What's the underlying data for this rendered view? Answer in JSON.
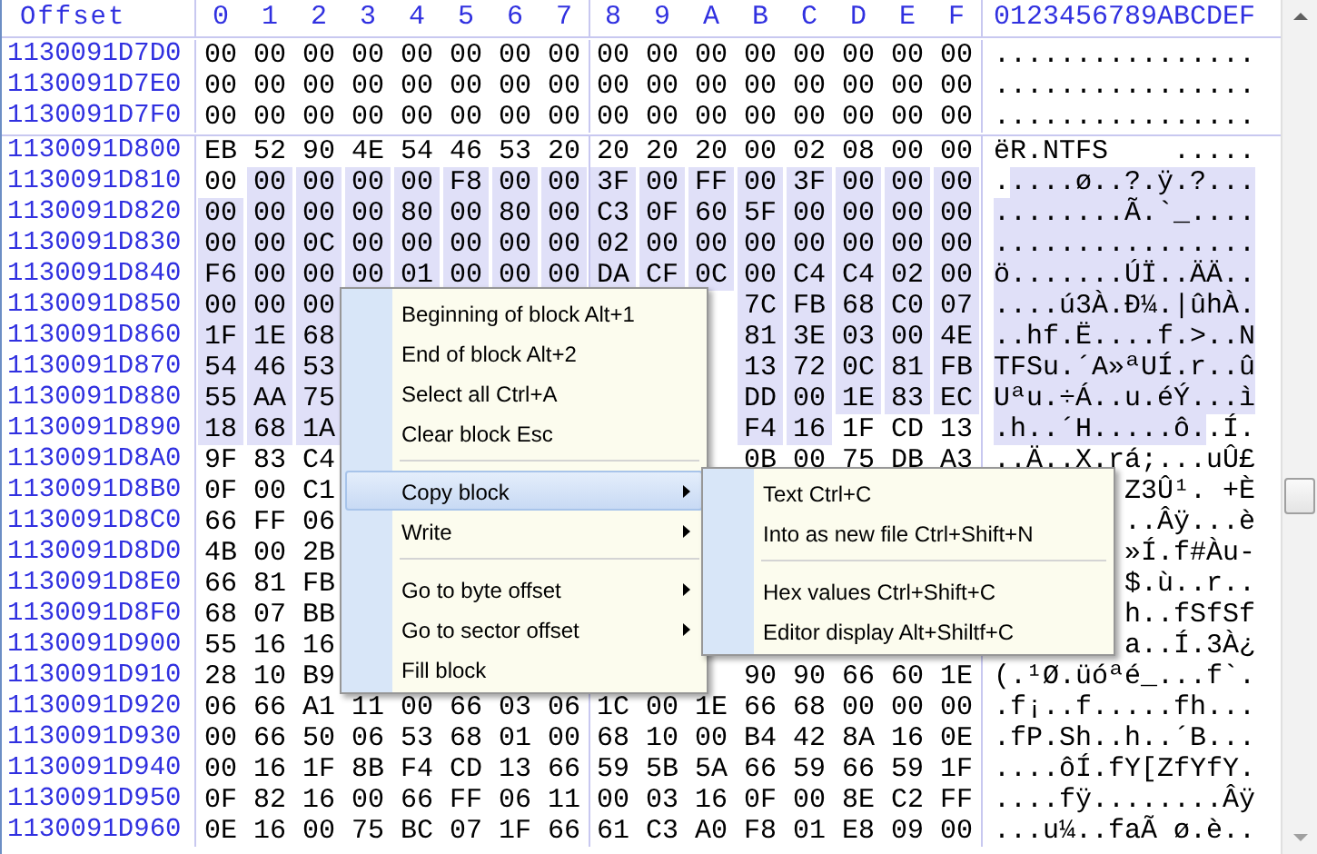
{
  "columns": {
    "offset": "Offset",
    "hex": [
      "0",
      "1",
      "2",
      "3",
      "4",
      "5",
      "6",
      "7",
      "8",
      "9",
      "A",
      "B",
      "C",
      "D",
      "E",
      "F"
    ],
    "text": "0123456789ABCDEF"
  },
  "rows": [
    {
      "offset": "1130091D7D0",
      "bytes": [
        {
          "v": "00",
          "selected": false
        },
        {
          "v": "00",
          "selected": false
        },
        {
          "v": "00",
          "selected": false
        },
        {
          "v": "00",
          "selected": false
        },
        {
          "v": "00",
          "selected": false
        },
        {
          "v": "00",
          "selected": false
        },
        {
          "v": "00",
          "selected": false
        },
        {
          "v": "00",
          "selected": false
        },
        {
          "v": "00",
          "selected": false
        },
        {
          "v": "00",
          "selected": false
        },
        {
          "v": "00",
          "selected": false
        },
        {
          "v": "00",
          "selected": false
        },
        {
          "v": "00",
          "selected": false
        },
        {
          "v": "00",
          "selected": false
        },
        {
          "v": "00",
          "selected": false
        },
        {
          "v": "00",
          "selected": false
        }
      ],
      "text": [
        {
          "s": "................",
          "selected": false
        }
      ]
    },
    {
      "offset": "1130091D7E0",
      "bytes": [
        {
          "v": "00",
          "selected": false
        },
        {
          "v": "00",
          "selected": false
        },
        {
          "v": "00",
          "selected": false
        },
        {
          "v": "00",
          "selected": false
        },
        {
          "v": "00",
          "selected": false
        },
        {
          "v": "00",
          "selected": false
        },
        {
          "v": "00",
          "selected": false
        },
        {
          "v": "00",
          "selected": false
        },
        {
          "v": "00",
          "selected": false
        },
        {
          "v": "00",
          "selected": false
        },
        {
          "v": "00",
          "selected": false
        },
        {
          "v": "00",
          "selected": false
        },
        {
          "v": "00",
          "selected": false
        },
        {
          "v": "00",
          "selected": false
        },
        {
          "v": "00",
          "selected": false
        },
        {
          "v": "00",
          "selected": false
        }
      ],
      "text": [
        {
          "s": "................",
          "selected": false
        }
      ]
    },
    {
      "offset": "1130091D7F0",
      "bytes": [
        {
          "v": "00",
          "selected": false
        },
        {
          "v": "00",
          "selected": false
        },
        {
          "v": "00",
          "selected": false
        },
        {
          "v": "00",
          "selected": false
        },
        {
          "v": "00",
          "selected": false
        },
        {
          "v": "00",
          "selected": false
        },
        {
          "v": "00",
          "selected": false
        },
        {
          "v": "00",
          "selected": false
        },
        {
          "v": "00",
          "selected": false
        },
        {
          "v": "00",
          "selected": false
        },
        {
          "v": "00",
          "selected": false
        },
        {
          "v": "00",
          "selected": false
        },
        {
          "v": "00",
          "selected": false
        },
        {
          "v": "00",
          "selected": false
        },
        {
          "v": "00",
          "selected": false
        },
        {
          "v": "00",
          "selected": false
        }
      ],
      "text": [
        {
          "s": "................",
          "selected": false
        }
      ]
    },
    {
      "offset": "1130091D800",
      "bytes": [
        {
          "v": "EB",
          "selected": false
        },
        {
          "v": "52",
          "selected": false
        },
        {
          "v": "90",
          "selected": false
        },
        {
          "v": "4E",
          "selected": false
        },
        {
          "v": "54",
          "selected": false
        },
        {
          "v": "46",
          "selected": false
        },
        {
          "v": "53",
          "selected": false
        },
        {
          "v": "20",
          "selected": false
        },
        {
          "v": "20",
          "selected": false
        },
        {
          "v": "20",
          "selected": false
        },
        {
          "v": "20",
          "selected": false
        },
        {
          "v": "00",
          "selected": false
        },
        {
          "v": "02",
          "selected": false
        },
        {
          "v": "08",
          "selected": false
        },
        {
          "v": "00",
          "selected": false
        },
        {
          "v": "00",
          "selected": false
        }
      ],
      "text": [
        {
          "s": "ëR.NTFS    .....",
          "selected": false
        }
      ]
    },
    {
      "offset": "1130091D810",
      "bytes": [
        {
          "v": "00",
          "selected": false
        },
        {
          "v": "00",
          "selected": true
        },
        {
          "v": "00",
          "selected": true
        },
        {
          "v": "00",
          "selected": true
        },
        {
          "v": "00",
          "selected": true
        },
        {
          "v": "F8",
          "selected": true
        },
        {
          "v": "00",
          "selected": true
        },
        {
          "v": "00",
          "selected": true
        },
        {
          "v": "3F",
          "selected": true
        },
        {
          "v": "00",
          "selected": true
        },
        {
          "v": "FF",
          "selected": true
        },
        {
          "v": "00",
          "selected": true
        },
        {
          "v": "3F",
          "selected": true
        },
        {
          "v": "00",
          "selected": true
        },
        {
          "v": "00",
          "selected": true
        },
        {
          "v": "00",
          "selected": true
        }
      ],
      "text": [
        {
          "s": ".",
          "selected": false
        },
        {
          "s": "....ø..?.ÿ.?...",
          "selected": true
        }
      ]
    },
    {
      "offset": "1130091D820",
      "bytes": [
        {
          "v": "00",
          "selected": true
        },
        {
          "v": "00",
          "selected": true
        },
        {
          "v": "00",
          "selected": true
        },
        {
          "v": "00",
          "selected": true
        },
        {
          "v": "80",
          "selected": true
        },
        {
          "v": "00",
          "selected": true
        },
        {
          "v": "80",
          "selected": true
        },
        {
          "v": "00",
          "selected": true
        },
        {
          "v": "C3",
          "selected": true
        },
        {
          "v": "0F",
          "selected": true
        },
        {
          "v": "60",
          "selected": true
        },
        {
          "v": "5F",
          "selected": true
        },
        {
          "v": "00",
          "selected": true
        },
        {
          "v": "00",
          "selected": true
        },
        {
          "v": "00",
          "selected": true
        },
        {
          "v": "00",
          "selected": true
        }
      ],
      "text": [
        {
          "s": "........Ã.`_....",
          "selected": true
        }
      ]
    },
    {
      "offset": "1130091D830",
      "bytes": [
        {
          "v": "00",
          "selected": true
        },
        {
          "v": "00",
          "selected": true
        },
        {
          "v": "0C",
          "selected": true
        },
        {
          "v": "00",
          "selected": true
        },
        {
          "v": "00",
          "selected": true
        },
        {
          "v": "00",
          "selected": true
        },
        {
          "v": "00",
          "selected": true
        },
        {
          "v": "00",
          "selected": true
        },
        {
          "v": "02",
          "selected": true
        },
        {
          "v": "00",
          "selected": true
        },
        {
          "v": "00",
          "selected": true
        },
        {
          "v": "00",
          "selected": true
        },
        {
          "v": "00",
          "selected": true
        },
        {
          "v": "00",
          "selected": true
        },
        {
          "v": "00",
          "selected": true
        },
        {
          "v": "00",
          "selected": true
        }
      ],
      "text": [
        {
          "s": "................",
          "selected": true
        }
      ]
    },
    {
      "offset": "1130091D840",
      "bytes": [
        {
          "v": "F6",
          "selected": true
        },
        {
          "v": "00",
          "selected": true
        },
        {
          "v": "00",
          "selected": true
        },
        {
          "v": "00",
          "selected": true
        },
        {
          "v": "01",
          "selected": true
        },
        {
          "v": "00",
          "selected": true
        },
        {
          "v": "00",
          "selected": true
        },
        {
          "v": "00",
          "selected": true
        },
        {
          "v": "DA",
          "selected": true
        },
        {
          "v": "CF",
          "selected": true
        },
        {
          "v": "0C",
          "selected": true
        },
        {
          "v": "00",
          "selected": true
        },
        {
          "v": "C4",
          "selected": true
        },
        {
          "v": "C4",
          "selected": true
        },
        {
          "v": "02",
          "selected": true
        },
        {
          "v": "00",
          "selected": true
        }
      ],
      "text": [
        {
          "s": "ö.......ÚÏ..ÄÄ..",
          "selected": true
        }
      ]
    },
    {
      "offset": "1130091D850",
      "bytes": [
        {
          "v": "00",
          "selected": true
        },
        {
          "v": "00",
          "selected": true
        },
        {
          "v": "00",
          "selected": true
        }
      ],
      "bytes_right": [
        {
          "v": "7C",
          "selected": true
        },
        {
          "v": "FB",
          "selected": true
        },
        {
          "v": "68",
          "selected": true
        },
        {
          "v": "C0",
          "selected": true
        },
        {
          "v": "07",
          "selected": true
        }
      ],
      "text": [
        {
          "s": "....ú3À.Ð¼.|ûhÀ.",
          "selected": true
        }
      ]
    },
    {
      "offset": "1130091D860",
      "bytes": [
        {
          "v": "1F",
          "selected": true
        },
        {
          "v": "1E",
          "selected": true
        },
        {
          "v": "68",
          "selected": true
        }
      ],
      "bytes_right": [
        {
          "v": "81",
          "selected": true
        },
        {
          "v": "3E",
          "selected": true
        },
        {
          "v": "03",
          "selected": true
        },
        {
          "v": "00",
          "selected": true
        },
        {
          "v": "4E",
          "selected": true
        }
      ],
      "text": [
        {
          "s": "..hf.Ë....f.>..N",
          "selected": true
        }
      ]
    },
    {
      "offset": "1130091D870",
      "bytes": [
        {
          "v": "54",
          "selected": true
        },
        {
          "v": "46",
          "selected": true
        },
        {
          "v": "53",
          "selected": true
        }
      ],
      "bytes_right": [
        {
          "v": "13",
          "selected": true
        },
        {
          "v": "72",
          "selected": true
        },
        {
          "v": "0C",
          "selected": true
        },
        {
          "v": "81",
          "selected": true
        },
        {
          "v": "FB",
          "selected": true
        }
      ],
      "text": [
        {
          "s": "TFSu.´A»ªUÍ.r..û",
          "selected": true
        }
      ]
    },
    {
      "offset": "1130091D880",
      "bytes": [
        {
          "v": "55",
          "selected": true
        },
        {
          "v": "AA",
          "selected": true
        },
        {
          "v": "75",
          "selected": true
        }
      ],
      "bytes_right": [
        {
          "v": "DD",
          "selected": true
        },
        {
          "v": "00",
          "selected": true
        },
        {
          "v": "1E",
          "selected": true
        },
        {
          "v": "83",
          "selected": true
        },
        {
          "v": "EC",
          "selected": true
        }
      ],
      "text": [
        {
          "s": "Uªu.÷Á..u.éÝ...ì",
          "selected": true
        }
      ]
    },
    {
      "offset": "1130091D890",
      "bytes": [
        {
          "v": "18",
          "selected": true
        },
        {
          "v": "68",
          "selected": true
        },
        {
          "v": "1A",
          "selected": true
        }
      ],
      "bytes_right": [
        {
          "v": "F4",
          "selected": true
        },
        {
          "v": "16",
          "selected": true
        },
        {
          "v": "1F",
          "selected": false
        },
        {
          "v": "CD",
          "selected": false
        },
        {
          "v": "13",
          "selected": false
        }
      ],
      "text": [
        {
          "s": ".h..´H.....ô.",
          "selected": true
        },
        {
          "s": ".Í.",
          "selected": false
        }
      ]
    },
    {
      "offset": "1130091D8A0",
      "bytes": [
        {
          "v": "9F",
          "selected": false
        },
        {
          "v": "83",
          "selected": false
        },
        {
          "v": "C4",
          "selected": false
        }
      ],
      "bytes_right": [
        {
          "v": "0B",
          "selected": false
        },
        {
          "v": "00",
          "selected": false
        },
        {
          "v": "75",
          "selected": false
        },
        {
          "v": "DB",
          "selected": false
        },
        {
          "v": "A3",
          "selected": false
        }
      ],
      "text": [
        {
          "s": "..Ä..X.rá;...uÛ£",
          "selected": false
        }
      ]
    },
    {
      "offset": "1130091D8B0",
      "bytes": [
        {
          "v": "0F",
          "selected": false
        },
        {
          "v": "00",
          "selected": false
        },
        {
          "v": "C1",
          "selected": false
        }
      ],
      "text": [
        {
          "s": "Z3Û¹. +È",
          "selected": false
        }
      ]
    },
    {
      "offset": "1130091D8C0",
      "bytes": [
        {
          "v": "66",
          "selected": false
        },
        {
          "v": "FF",
          "selected": false
        },
        {
          "v": "06",
          "selected": false
        }
      ],
      "text": [
        {
          "s": "..Âÿ...è",
          "selected": false
        }
      ]
    },
    {
      "offset": "1130091D8D0",
      "bytes": [
        {
          "v": "4B",
          "selected": false
        },
        {
          "v": "00",
          "selected": false
        },
        {
          "v": "2B",
          "selected": false
        }
      ],
      "text": [
        {
          "s": "»Í.f#Àu-",
          "selected": false
        }
      ]
    },
    {
      "offset": "1130091D8E0",
      "bytes": [
        {
          "v": "66",
          "selected": false
        },
        {
          "v": "81",
          "selected": false
        },
        {
          "v": "FB",
          "selected": false
        }
      ],
      "text": [
        {
          "s": "$.ù..r..",
          "selected": false
        }
      ]
    },
    {
      "offset": "1130091D8F0",
      "bytes": [
        {
          "v": "68",
          "selected": false
        },
        {
          "v": "07",
          "selected": false
        },
        {
          "v": "BB",
          "selected": false
        }
      ],
      "text": [
        {
          "s": "h..fSfSf",
          "selected": false
        }
      ]
    },
    {
      "offset": "1130091D900",
      "bytes": [
        {
          "v": "55",
          "selected": false
        },
        {
          "v": "16",
          "selected": false
        },
        {
          "v": "16",
          "selected": false
        }
      ],
      "text": [
        {
          "s": "a..Í.3À¿",
          "selected": false
        }
      ]
    },
    {
      "offset": "1130091D910",
      "bytes": [
        {
          "v": "28",
          "selected": false
        },
        {
          "v": "10",
          "selected": false
        },
        {
          "v": "B9",
          "selected": false
        }
      ],
      "bytes_right": [
        {
          "v": "90",
          "selected": false
        },
        {
          "v": "90",
          "selected": false
        },
        {
          "v": "66",
          "selected": false
        },
        {
          "v": "60",
          "selected": false
        },
        {
          "v": "1E",
          "selected": false
        }
      ],
      "text": [
        {
          "s": "(.¹Ø.üóªé_...f`.",
          "selected": false
        }
      ]
    },
    {
      "offset": "1130091D920",
      "bytes": [
        {
          "v": "06",
          "selected": false
        },
        {
          "v": "66",
          "selected": false
        },
        {
          "v": "A1",
          "selected": false
        },
        {
          "v": "11",
          "selected": false
        },
        {
          "v": "00",
          "selected": false
        },
        {
          "v": "66",
          "selected": false
        },
        {
          "v": "03",
          "selected": false
        },
        {
          "v": "06",
          "selected": false
        },
        {
          "v": "1C",
          "selected": false
        },
        {
          "v": "00",
          "selected": false
        },
        {
          "v": "1E",
          "selected": false
        },
        {
          "v": "66",
          "selected": false
        },
        {
          "v": "68",
          "selected": false
        },
        {
          "v": "00",
          "selected": false
        },
        {
          "v": "00",
          "selected": false
        },
        {
          "v": "00",
          "selected": false
        }
      ],
      "text": [
        {
          "s": ".f¡..f.....fh...",
          "selected": false
        }
      ]
    },
    {
      "offset": "1130091D930",
      "bytes": [
        {
          "v": "00",
          "selected": false
        },
        {
          "v": "66",
          "selected": false
        },
        {
          "v": "50",
          "selected": false
        },
        {
          "v": "06",
          "selected": false
        },
        {
          "v": "53",
          "selected": false
        },
        {
          "v": "68",
          "selected": false
        },
        {
          "v": "01",
          "selected": false
        },
        {
          "v": "00",
          "selected": false
        },
        {
          "v": "68",
          "selected": false
        },
        {
          "v": "10",
          "selected": false
        },
        {
          "v": "00",
          "selected": false
        },
        {
          "v": "B4",
          "selected": false
        },
        {
          "v": "42",
          "selected": false
        },
        {
          "v": "8A",
          "selected": false
        },
        {
          "v": "16",
          "selected": false
        },
        {
          "v": "0E",
          "selected": false
        }
      ],
      "text": [
        {
          "s": ".fP.Sh..h..´B...",
          "selected": false
        }
      ]
    },
    {
      "offset": "1130091D940",
      "bytes": [
        {
          "v": "00",
          "selected": false
        },
        {
          "v": "16",
          "selected": false
        },
        {
          "v": "1F",
          "selected": false
        },
        {
          "v": "8B",
          "selected": false
        },
        {
          "v": "F4",
          "selected": false
        },
        {
          "v": "CD",
          "selected": false
        },
        {
          "v": "13",
          "selected": false
        },
        {
          "v": "66",
          "selected": false
        },
        {
          "v": "59",
          "selected": false
        },
        {
          "v": "5B",
          "selected": false
        },
        {
          "v": "5A",
          "selected": false
        },
        {
          "v": "66",
          "selected": false
        },
        {
          "v": "59",
          "selected": false
        },
        {
          "v": "66",
          "selected": false
        },
        {
          "v": "59",
          "selected": false
        },
        {
          "v": "1F",
          "selected": false
        }
      ],
      "text": [
        {
          "s": "....ôÍ.fY[ZfYfY.",
          "selected": false
        }
      ]
    },
    {
      "offset": "1130091D950",
      "bytes": [
        {
          "v": "0F",
          "selected": false
        },
        {
          "v": "82",
          "selected": false
        },
        {
          "v": "16",
          "selected": false
        },
        {
          "v": "00",
          "selected": false
        },
        {
          "v": "66",
          "selected": false
        },
        {
          "v": "FF",
          "selected": false
        },
        {
          "v": "06",
          "selected": false
        },
        {
          "v": "11",
          "selected": false
        },
        {
          "v": "00",
          "selected": false
        },
        {
          "v": "03",
          "selected": false
        },
        {
          "v": "16",
          "selected": false
        },
        {
          "v": "0F",
          "selected": false
        },
        {
          "v": "00",
          "selected": false
        },
        {
          "v": "8E",
          "selected": false
        },
        {
          "v": "C2",
          "selected": false
        },
        {
          "v": "FF",
          "selected": false
        }
      ],
      "text": [
        {
          "s": "....fÿ........Âÿ",
          "selected": false
        }
      ]
    },
    {
      "offset": "1130091D960",
      "bytes": [
        {
          "v": "0E",
          "selected": false
        },
        {
          "v": "16",
          "selected": false
        },
        {
          "v": "00",
          "selected": false
        },
        {
          "v": "75",
          "selected": false
        },
        {
          "v": "BC",
          "selected": false
        },
        {
          "v": "07",
          "selected": false
        },
        {
          "v": "1F",
          "selected": false
        },
        {
          "v": "66",
          "selected": false
        },
        {
          "v": "61",
          "selected": false
        },
        {
          "v": "C3",
          "selected": false
        },
        {
          "v": "A0",
          "selected": false
        },
        {
          "v": "F8",
          "selected": false
        },
        {
          "v": "01",
          "selected": false
        },
        {
          "v": "E8",
          "selected": false
        },
        {
          "v": "09",
          "selected": false
        },
        {
          "v": "00",
          "selected": false
        }
      ],
      "text": [
        {
          "s": "...u¼..faÃ ø.è..",
          "selected": false
        }
      ]
    }
  ],
  "context_menu": {
    "items": [
      {
        "kind": "item",
        "label": "Beginning of block Alt+1",
        "submenu": false,
        "selected": false
      },
      {
        "kind": "item",
        "label": "End of block Alt+2",
        "submenu": false,
        "selected": false
      },
      {
        "kind": "item",
        "label": "Select all Ctrl+A",
        "submenu": false,
        "selected": false
      },
      {
        "kind": "item",
        "label": "Clear block Esc",
        "submenu": false,
        "selected": false
      },
      {
        "kind": "separator"
      },
      {
        "kind": "item",
        "label": "Copy block",
        "submenu": true,
        "selected": true
      },
      {
        "kind": "item",
        "label": "Write",
        "submenu": true,
        "selected": false
      },
      {
        "kind": "separator"
      },
      {
        "kind": "item",
        "label": "Go to byte offset",
        "submenu": true,
        "selected": false
      },
      {
        "kind": "item",
        "label": "Go to sector offset",
        "submenu": true,
        "selected": false
      },
      {
        "kind": "item",
        "label": "Fill block",
        "submenu": false,
        "selected": false
      }
    ]
  },
  "submenu": {
    "items": [
      {
        "kind": "item",
        "label": "Text Ctrl+C",
        "submenu": false,
        "selected": false
      },
      {
        "kind": "item",
        "label": "Into as new file Ctrl+Shift+N",
        "submenu": false,
        "selected": false
      },
      {
        "kind": "separator"
      },
      {
        "kind": "item",
        "label": "Hex values Ctrl+Shift+C",
        "submenu": false,
        "selected": false
      },
      {
        "kind": "item",
        "label": "Editor display Alt+Shiltf+C",
        "submenu": false,
        "selected": false
      }
    ]
  }
}
